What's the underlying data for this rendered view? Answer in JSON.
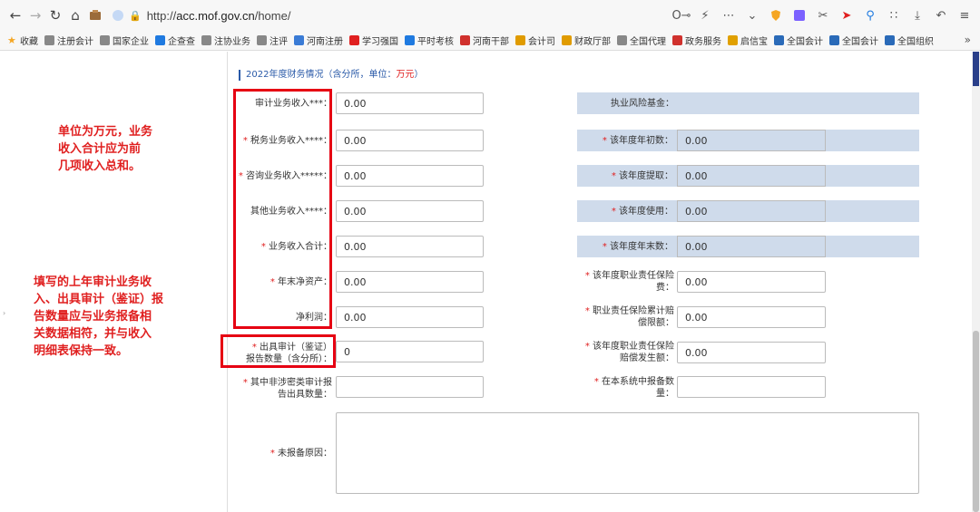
{
  "browser": {
    "url_prefix": "http://",
    "url_host": "acc.mof.gov.cn",
    "url_path": "/home/"
  },
  "bookmarks": [
    {
      "label": "收藏",
      "color": "#f5a623"
    },
    {
      "label": "注册会计",
      "color": "#888888"
    },
    {
      "label": "国家企业",
      "color": "#888888"
    },
    {
      "label": "企查查",
      "color": "#1f7ae0"
    },
    {
      "label": "注协业务",
      "color": "#888888"
    },
    {
      "label": "注评",
      "color": "#888888"
    },
    {
      "label": "河南注册",
      "color": "#3a7bd5"
    },
    {
      "label": "学习强国",
      "color": "#e02020"
    },
    {
      "label": "平时考核",
      "color": "#1f7ae0"
    },
    {
      "label": "河南干部",
      "color": "#d0312d"
    },
    {
      "label": "会计司",
      "color": "#e09b00"
    },
    {
      "label": "财政厅部",
      "color": "#e09b00"
    },
    {
      "label": "全国代理",
      "color": "#888888"
    },
    {
      "label": "政务服务",
      "color": "#d0312d"
    },
    {
      "label": "启信宝",
      "color": "#e0a000"
    },
    {
      "label": "全国会计",
      "color": "#2a6ab8"
    },
    {
      "label": "全国会计",
      "color": "#2a6ab8"
    },
    {
      "label": "全国组织",
      "color": "#2a6ab8"
    }
  ],
  "notes": {
    "note1": [
      "单位为万元，业务",
      "收入合计应为前",
      "几项收入总和。"
    ],
    "note2": [
      "填写的上年审计业务收",
      "入、出具审计（鉴证）报",
      "告数量应与业务报备相",
      "关数据相符，并与收入",
      "明细表保持一致。"
    ]
  },
  "section": {
    "title": "2022年度财务情况（含分所，单位：",
    "unit": "万元",
    "close": "）"
  },
  "left_fields": [
    {
      "label": "审计业务收入***：",
      "required": false,
      "value": "0.00"
    },
    {
      "label": "税务业务收入****：",
      "required": true,
      "value": "0.00"
    },
    {
      "label": "咨询业务收入*****：",
      "required": true,
      "value": "0.00"
    },
    {
      "label": "其他业务收入****：",
      "required": false,
      "value": "0.00"
    },
    {
      "label": "业务收入合计：",
      "required": true,
      "value": "0.00"
    },
    {
      "label": "年末净资产：",
      "required": true,
      "value": "0.00"
    },
    {
      "label": "净利润：",
      "required": false,
      "value": "0.00"
    }
  ],
  "report_count": {
    "label_line1": "出具审计（鉴证）",
    "label_line2": "报告数量（含分所）：",
    "value": "0"
  },
  "non_secret": {
    "label_line1": "其中非涉密类审计报",
    "label_line2": "告出具数量：",
    "value": ""
  },
  "reason": {
    "label": "未报备原因：",
    "value": ""
  },
  "right_fields": {
    "risk_fund": {
      "label": "执业风险基金："
    },
    "begin": {
      "label": "该年度年初数：",
      "value": "0.00"
    },
    "draw": {
      "label": "该年度提取：",
      "value": "0.00"
    },
    "use": {
      "label": "该年度使用：",
      "value": "0.00"
    },
    "end": {
      "label": "该年度年末数：",
      "value": "0.00"
    },
    "premium": {
      "label_line1": "该年度职业责任保险",
      "label_line2": "费：",
      "value": "0.00"
    },
    "limit": {
      "label_line1": "职业责任保险累计赔",
      "label_line2": "偿限额：",
      "value": "0.00"
    },
    "claims": {
      "label_line1": "该年度职业责任保险",
      "label_line2": "赔偿发生额：",
      "value": "0.00"
    },
    "filed": {
      "label_line1": "在本系统中报备数",
      "label_line2": "量：",
      "value": ""
    }
  },
  "colors": {
    "required": "#e02020",
    "highlight_box": "#e60012",
    "fund_bar": "#cfdbeb"
  }
}
